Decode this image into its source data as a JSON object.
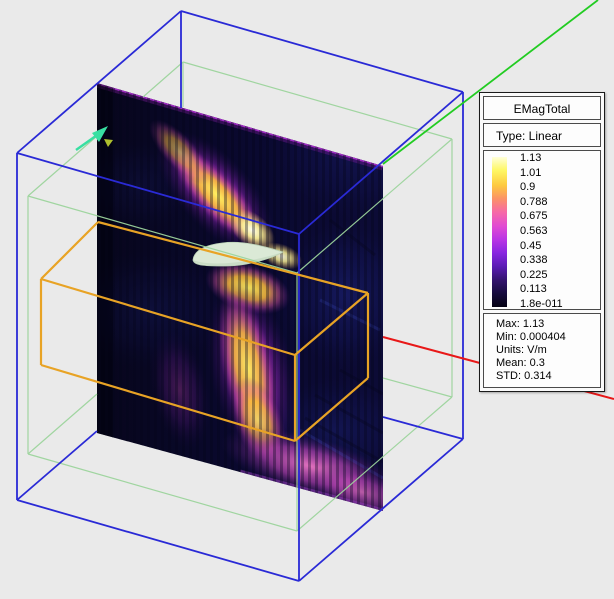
{
  "legend": {
    "title": "EMagTotal",
    "type_label": "Type: Linear",
    "ticks": [
      "1.13",
      "1.01",
      "0.9",
      "0.788",
      "0.675",
      "0.563",
      "0.45",
      "0.338",
      "0.225",
      "0.113",
      "1.8e-011"
    ],
    "stats": [
      "Max: 1.13",
      "Min: 0.000404",
      "Units: V/m",
      "Mean: 0.3",
      "STD: 0.314"
    ]
  },
  "scene": {
    "plot_quantity": "EMagTotal",
    "colors": {
      "background": "#eaeaea",
      "outer_region_box": "#2a2ad6",
      "inner_region_box": "#9cd49c",
      "field_volume_box": "#e8a325",
      "x_axis": "#e81818",
      "y_axis": "#22cc22",
      "excitation_arrow": "#38dfa2",
      "airfoil": "#dbe9d6",
      "plane_edge_glow": "#a12cc4"
    },
    "colormap": [
      "#ffffd9",
      "#fef763",
      "#fdc93f",
      "#fb9168",
      "#f668a8",
      "#e14bd2",
      "#b935e4",
      "#8825e0",
      "#5a1bb4",
      "#33136e",
      "#160b3d",
      "#050213"
    ],
    "markers": [
      "excitation-arrow",
      "triad-marker"
    ]
  }
}
